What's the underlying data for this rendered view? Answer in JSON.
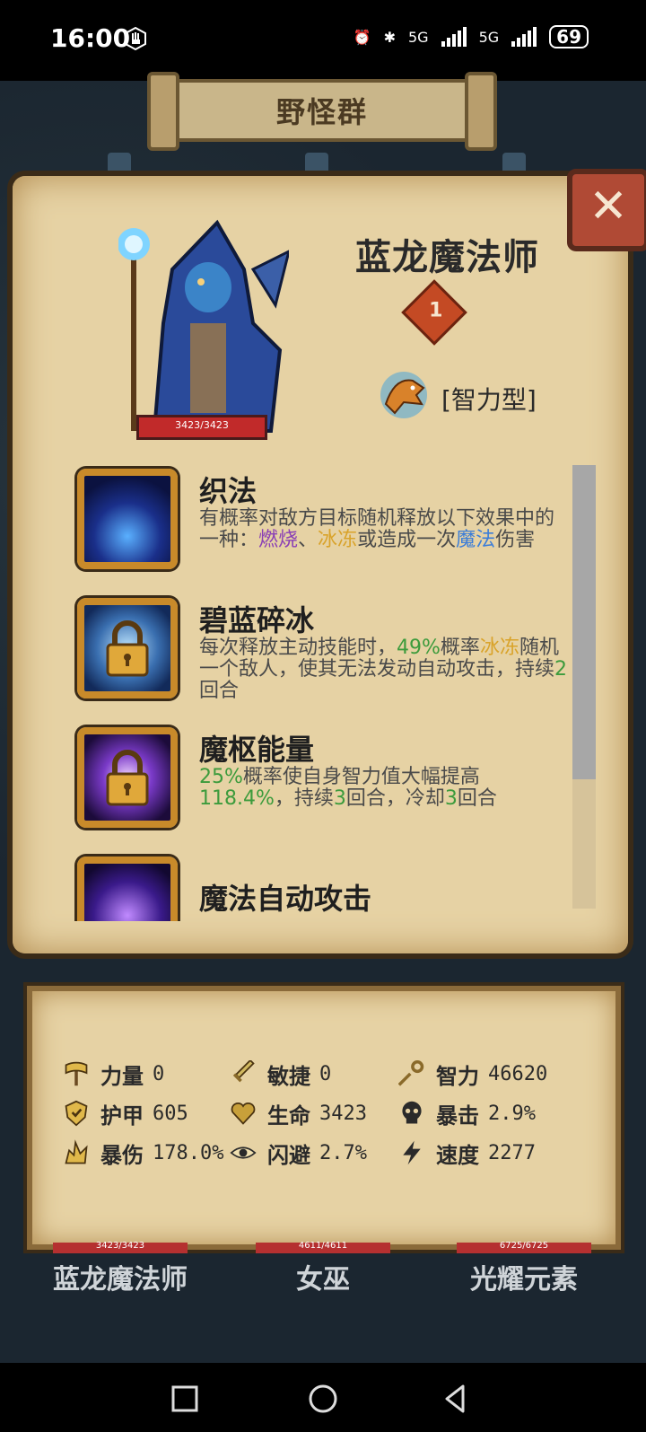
{
  "status_bar": {
    "time": "16:00",
    "signal_1": "5G",
    "signal_2": "5G",
    "battery": "69"
  },
  "header": {
    "title": "野怪群"
  },
  "monster": {
    "name": "蓝龙魔法师",
    "rank": "1",
    "hp": "3423/3423",
    "type_label": "[智力型]"
  },
  "skills": [
    {
      "name": "织法",
      "desc_parts": [
        "有概率对敌方目标随机释放以下效果中的一种：",
        "燃烧",
        "、",
        "冰冻",
        "或造成一次",
        "魔法",
        "伤害"
      ]
    },
    {
      "name": "碧蓝碎冰",
      "desc_parts": [
        "每次释放主动技能时，",
        "49%",
        "概率",
        "冰冻",
        "随机一个敌人，使其无法发动自动攻击，持续",
        "2",
        "回合"
      ]
    },
    {
      "name": "魔枢能量",
      "desc_parts": [
        "25%",
        "概率使自身智力值大幅提高",
        "118.4%",
        "，持续",
        "3",
        "回合，冷却",
        "3",
        "回合"
      ]
    },
    {
      "name": "魔法自动攻击",
      "desc_parts": []
    }
  ],
  "stats": {
    "strength": {
      "label": "力量",
      "value": "0"
    },
    "agility": {
      "label": "敏捷",
      "value": "0"
    },
    "intellect": {
      "label": "智力",
      "value": "46620"
    },
    "armor": {
      "label": "护甲",
      "value": "605"
    },
    "life": {
      "label": "生命",
      "value": "3423"
    },
    "crit": {
      "label": "暴击",
      "value": "2.9%"
    },
    "crit_damage": {
      "label": "暴伤",
      "value": "178.0%"
    },
    "dodge": {
      "label": "闪避",
      "value": "2.7%"
    },
    "speed": {
      "label": "速度",
      "value": "2277"
    }
  },
  "party": [
    {
      "name": "蓝龙魔法师",
      "hp": "3423/3423"
    },
    {
      "name": "女巫",
      "hp": "4611/4611"
    },
    {
      "name": "光耀元素",
      "hp": "6725/6725"
    }
  ],
  "colors": {
    "burn": "#8a3fb5",
    "frost": "#d9a32a",
    "magic": "#3b7dd8",
    "green": "#3c9b3c"
  }
}
